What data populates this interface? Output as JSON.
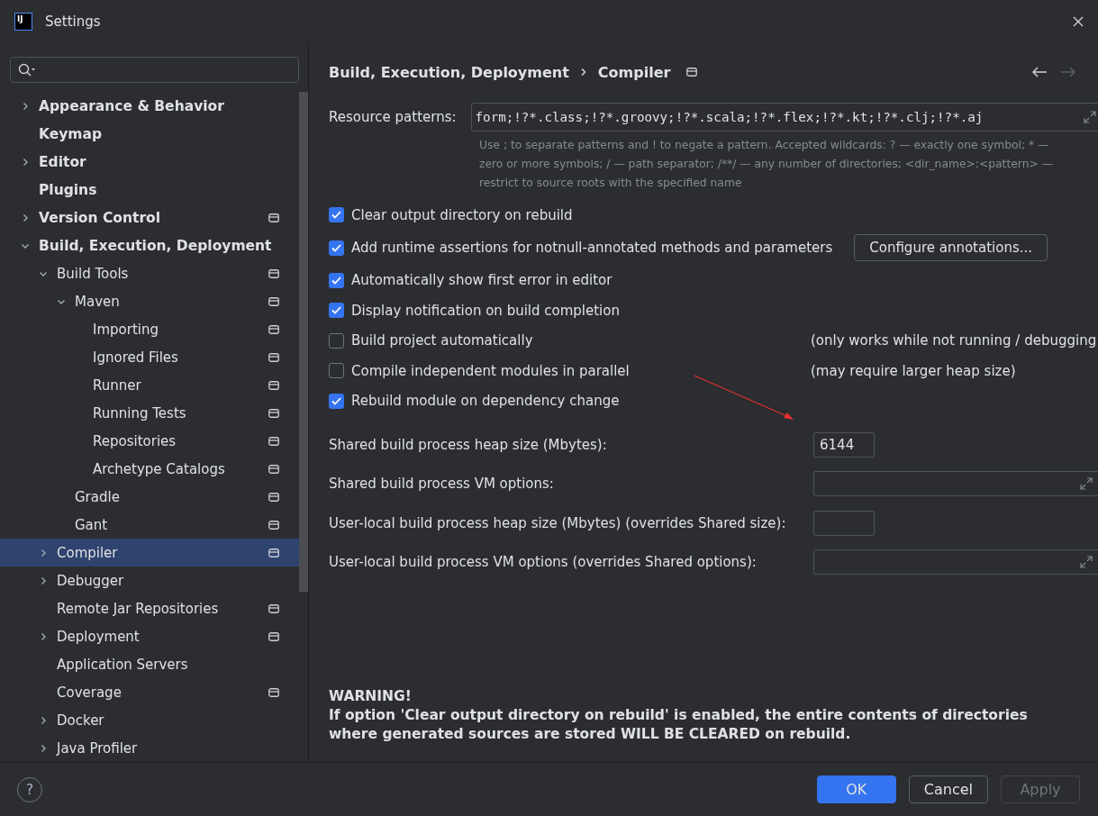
{
  "window": {
    "title": "Settings",
    "logo": "IJ"
  },
  "tree": [
    {
      "label": "Appearance & Behavior",
      "expanded": false,
      "scoped": false,
      "selected": false
    },
    {
      "label": "Keymap",
      "scoped": false,
      "selected": false
    },
    {
      "label": "Editor",
      "expanded": false,
      "scoped": false,
      "selected": false
    },
    {
      "label": "Plugins",
      "scoped": false,
      "selected": false
    },
    {
      "label": "Version Control",
      "expanded": false,
      "scoped": true,
      "selected": false
    },
    {
      "label": "Build, Execution, Deployment",
      "expanded": true,
      "scoped": false,
      "selected": false,
      "children": [
        {
          "label": "Build Tools",
          "expanded": true,
          "scoped": true,
          "selected": false,
          "children": [
            {
              "label": "Maven",
              "expanded": true,
              "scoped": true,
              "selected": false,
              "children": [
                {
                  "label": "Importing",
                  "scoped": true,
                  "selected": false
                },
                {
                  "label": "Ignored Files",
                  "scoped": true,
                  "selected": false
                },
                {
                  "label": "Runner",
                  "scoped": true,
                  "selected": false
                },
                {
                  "label": "Running Tests",
                  "scoped": true,
                  "selected": false
                },
                {
                  "label": "Repositories",
                  "scoped": true,
                  "selected": false
                },
                {
                  "label": "Archetype Catalogs",
                  "scoped": true,
                  "selected": false
                }
              ]
            },
            {
              "label": "Gradle",
              "scoped": true,
              "selected": false
            },
            {
              "label": "Gant",
              "scoped": true,
              "selected": false
            }
          ]
        },
        {
          "label": "Compiler",
          "expanded": false,
          "scoped": true,
          "selected": true
        },
        {
          "label": "Debugger",
          "expanded": false,
          "scoped": false,
          "selected": false
        },
        {
          "label": "Remote Jar Repositories",
          "scoped": true,
          "selected": false
        },
        {
          "label": "Deployment",
          "expanded": false,
          "scoped": true,
          "selected": false
        },
        {
          "label": "Application Servers",
          "scoped": false,
          "selected": false
        },
        {
          "label": "Coverage",
          "scoped": true,
          "selected": false
        },
        {
          "label": "Docker",
          "expanded": false,
          "scoped": false,
          "selected": false
        },
        {
          "label": "Java Profiler",
          "expanded": false,
          "scoped": false,
          "selected": false
        }
      ]
    }
  ],
  "breadcrumb": [
    "Build, Execution, Deployment",
    "Compiler"
  ],
  "resource_patterns": {
    "label": "Resource patterns:",
    "value": "form;!?*.class;!?*.groovy;!?*.scala;!?*.flex;!?*.kt;!?*.clj;!?*.aj",
    "hint": "Use ; to separate patterns and ! to negate a pattern. Accepted wildcards: ? — exactly one symbol; * — zero or more symbols; / — path separator; /**/ — any number of directories; <dir_name>:<pattern> — restrict to source roots with the specified name"
  },
  "options": [
    {
      "label": "Clear output directory on rebuild",
      "checked": true
    },
    {
      "label": "Add runtime assertions for notnull-annotated methods and parameters",
      "checked": true,
      "button": "Configure annotations..."
    },
    {
      "label": "Automatically show first error in editor",
      "checked": true
    },
    {
      "label": "Display notification on build completion",
      "checked": true
    },
    {
      "label": "Build project automatically",
      "checked": false,
      "note": "(only works while not running / debugging"
    },
    {
      "label": "Compile independent modules in parallel",
      "checked": false,
      "note": "(may require larger heap size)"
    },
    {
      "label": "Rebuild module on dependency change",
      "checked": true
    }
  ],
  "fields": [
    {
      "label": "Shared build process heap size (Mbytes):",
      "value": "6144",
      "kind": "short"
    },
    {
      "label": "Shared build process VM options:",
      "kind": "expandable"
    },
    {
      "label": "User-local build process heap size (Mbytes) (overrides Shared size):",
      "kind": "short"
    },
    {
      "label": "User-local build process VM options (overrides Shared options):",
      "kind": "expandable"
    }
  ],
  "annotation_arrow": true,
  "warning": {
    "title": "WARNING!",
    "text": "If option 'Clear output directory on rebuild' is enabled, the entire contents of directories where generated sources are stored WILL BE CLEARED on rebuild."
  },
  "help": "?",
  "buttons": [
    {
      "label": "OK",
      "kind": "primary",
      "disabled": false
    },
    {
      "label": "Cancel",
      "kind": "normal",
      "disabled": false
    },
    {
      "label": "Apply",
      "kind": "normal",
      "disabled": true
    }
  ]
}
